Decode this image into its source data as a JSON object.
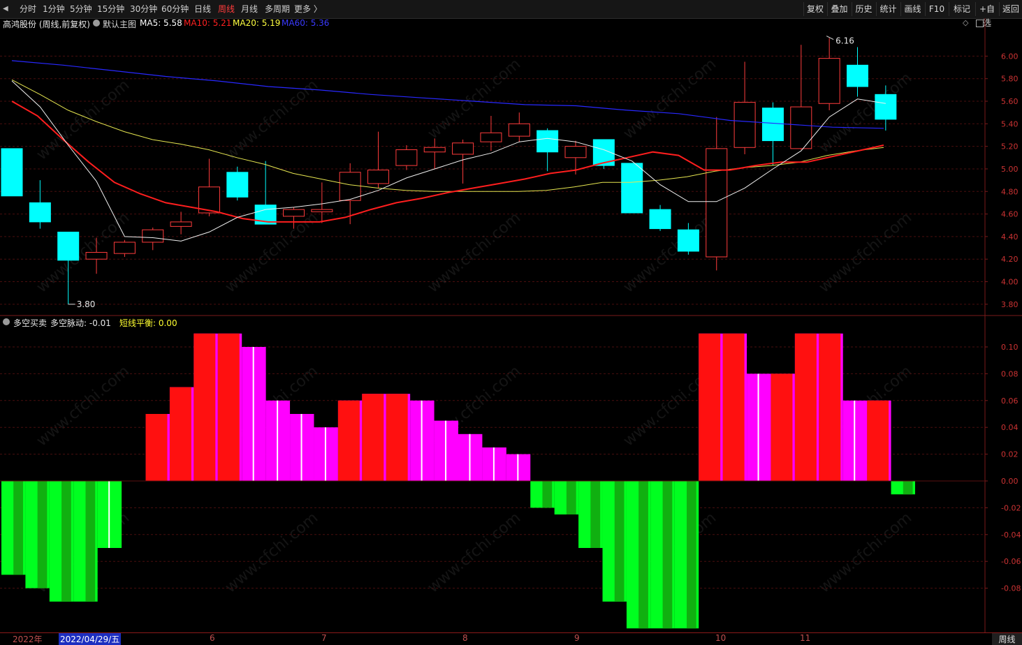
{
  "toolbar": {
    "back_icon": "back-arrow",
    "periods": [
      {
        "label": "分时",
        "active": false
      },
      {
        "label": "1分钟",
        "active": false
      },
      {
        "label": "5分钟",
        "active": false
      },
      {
        "label": "15分钟",
        "active": false
      },
      {
        "label": "30分钟",
        "active": false
      },
      {
        "label": "60分钟",
        "active": false
      },
      {
        "label": "日线",
        "active": false
      },
      {
        "label": "周线",
        "active": true
      },
      {
        "label": "月线",
        "active": false
      },
      {
        "label": "多周期",
        "active": false
      },
      {
        "label": "更多 〉",
        "active": false
      }
    ],
    "right_buttons": [
      "复权",
      "叠加",
      "历史",
      "统计",
      "画线",
      "F10",
      "标记",
      "+自选",
      "返回"
    ]
  },
  "main_chart": {
    "stock_title": "高鸿股份 (周线,前复权)",
    "template_label": "默认主图",
    "ma": [
      {
        "label": "MA5: 5.58",
        "color": "#ffffff"
      },
      {
        "label": "MA10: 5.21",
        "color": "#ff2020"
      },
      {
        "label": "MA20: 5.19",
        "color": "#ffff40"
      },
      {
        "label": "MA60: 5.36",
        "color": "#3a3aff"
      }
    ],
    "price_axis": [
      "6.00",
      "5.80",
      "5.60",
      "5.40",
      "5.20",
      "5.00",
      "4.80",
      "4.60",
      "4.40",
      "4.20",
      "4.00",
      "3.80"
    ],
    "high_label": "6.16",
    "low_label": "3.80",
    "watermark": "www.cfchi.com"
  },
  "sub_chart": {
    "indicator_name": "多空买卖",
    "value1": "多空脉动: -0.01",
    "value2": "短线平衡: 0.00",
    "axis": [
      "0.10",
      "0.08",
      "0.06",
      "0.04",
      "0.02",
      "0.00",
      "-0.02",
      "-0.04",
      "-0.06",
      "-0.08"
    ]
  },
  "footer": {
    "year": "2022年",
    "cursor_date": "2022/04/29/五",
    "months": [
      "6",
      "7",
      "8",
      "9",
      "10",
      "11"
    ],
    "period": "周线"
  },
  "colors": {
    "up": "#ff3c3c",
    "down": "#00ffff",
    "positive_bar": "#ff00ff",
    "negative_bar": "#00ff20",
    "accent": "#ff3c3c"
  },
  "chart_data": [
    {
      "type": "candlestick",
      "title": "高鸿股份 (周线,前复权)",
      "ylim": [
        3.7,
        6.25
      ],
      "candles": [
        {
          "o": 5.18,
          "h": 5.18,
          "l": 4.76,
          "c": 4.76
        },
        {
          "o": 4.7,
          "h": 4.9,
          "l": 4.47,
          "c": 4.53
        },
        {
          "o": 4.44,
          "h": 4.44,
          "l": 3.8,
          "c": 4.19
        },
        {
          "o": 4.2,
          "h": 4.39,
          "l": 4.07,
          "c": 4.26
        },
        {
          "o": 4.25,
          "h": 4.37,
          "l": 4.22,
          "c": 4.35
        },
        {
          "o": 4.35,
          "h": 4.48,
          "l": 4.28,
          "c": 4.46
        },
        {
          "o": 4.49,
          "h": 4.62,
          "l": 4.42,
          "c": 4.53
        },
        {
          "o": 4.61,
          "h": 5.09,
          "l": 4.58,
          "c": 4.84
        },
        {
          "o": 4.97,
          "h": 5.02,
          "l": 4.72,
          "c": 4.75
        },
        {
          "o": 4.68,
          "h": 5.07,
          "l": 4.57,
          "c": 4.51
        },
        {
          "o": 4.58,
          "h": 4.66,
          "l": 4.47,
          "c": 4.64
        },
        {
          "o": 4.62,
          "h": 4.88,
          "l": 4.52,
          "c": 4.64
        },
        {
          "o": 4.72,
          "h": 5.05,
          "l": 4.51,
          "c": 4.97
        },
        {
          "o": 4.87,
          "h": 5.33,
          "l": 4.83,
          "c": 4.99
        },
        {
          "o": 5.03,
          "h": 5.21,
          "l": 4.99,
          "c": 5.17
        },
        {
          "o": 5.15,
          "h": 5.27,
          "l": 5.0,
          "c": 5.19
        },
        {
          "o": 5.13,
          "h": 5.26,
          "l": 4.87,
          "c": 5.23
        },
        {
          "o": 5.24,
          "h": 5.47,
          "l": 5.16,
          "c": 5.32
        },
        {
          "o": 5.29,
          "h": 5.5,
          "l": 5.24,
          "c": 5.4
        },
        {
          "o": 5.34,
          "h": 5.36,
          "l": 4.98,
          "c": 5.15
        },
        {
          "o": 5.1,
          "h": 5.25,
          "l": 4.95,
          "c": 5.2
        },
        {
          "o": 5.26,
          "h": 5.26,
          "l": 5.0,
          "c": 5.03
        },
        {
          "o": 5.05,
          "h": 5.05,
          "l": 4.61,
          "c": 4.61
        },
        {
          "o": 4.64,
          "h": 4.68,
          "l": 4.45,
          "c": 4.47
        },
        {
          "o": 4.46,
          "h": 4.52,
          "l": 4.24,
          "c": 4.27
        },
        {
          "o": 4.22,
          "h": 5.46,
          "l": 4.1,
          "c": 5.18
        },
        {
          "o": 5.19,
          "h": 5.95,
          "l": 5.13,
          "c": 5.59
        },
        {
          "o": 5.54,
          "h": 5.59,
          "l": 5.03,
          "c": 5.25
        },
        {
          "o": 5.18,
          "h": 6.1,
          "l": 5.17,
          "c": 5.55
        },
        {
          "o": 5.58,
          "h": 6.16,
          "l": 5.52,
          "c": 5.98
        },
        {
          "o": 5.92,
          "h": 6.08,
          "l": 5.64,
          "c": 5.73
        },
        {
          "o": 5.66,
          "h": 5.74,
          "l": 5.34,
          "c": 5.44
        }
      ],
      "ma5": [
        null,
        null,
        null,
        null,
        4.4,
        4.39,
        4.36,
        4.44,
        4.57,
        4.64,
        4.66,
        4.69,
        4.73,
        4.81,
        4.92,
        5.0,
        5.08,
        5.14,
        5.24,
        5.27,
        5.24,
        5.17,
        5.07,
        4.86,
        4.71,
        4.71,
        4.83,
        5.0,
        5.16,
        5.46,
        5.62,
        5.58
      ],
      "ma10": [
        5.6,
        5.47,
        5.26,
        5.06,
        4.88,
        4.78,
        4.7,
        4.66,
        4.62,
        4.56,
        4.53,
        4.53,
        4.53,
        4.57,
        4.64,
        4.7,
        4.74,
        4.79,
        4.83,
        4.87,
        4.91,
        4.96,
        4.99,
        5.05,
        5.1,
        5.15,
        5.12,
        4.99,
        4.99,
        5.03,
        5.06,
        5.06,
        5.11,
        5.16,
        5.21
      ],
      "ma20": [
        5.79,
        5.66,
        5.52,
        5.42,
        5.33,
        5.26,
        5.22,
        5.17,
        5.1,
        5.04,
        4.96,
        4.91,
        4.86,
        4.83,
        4.81,
        4.8,
        4.8,
        4.8,
        4.8,
        4.81,
        4.84,
        4.88,
        4.88,
        4.9,
        4.93,
        4.98,
        5.01,
        5.03,
        5.06,
        5.12,
        5.16,
        5.19
      ],
      "ma60": [
        5.96,
        5.92,
        5.87,
        5.82,
        5.78,
        5.73,
        5.7,
        5.66,
        5.63,
        5.6,
        5.57,
        5.56,
        5.52,
        5.49,
        5.43,
        5.4,
        5.37,
        5.36
      ]
    },
    {
      "type": "bar",
      "title": "多空买卖",
      "series": [
        {
          "name": "多空脉动",
          "values": [
            -0.07,
            -0.08,
            -0.09,
            -0.09,
            -0.05,
            0.0,
            0.05,
            0.07,
            0.11,
            0.11,
            0.1,
            0.06,
            0.05,
            0.04,
            0.06,
            0.065,
            0.065,
            0.06,
            0.045,
            0.035,
            0.025,
            0.02,
            -0.02,
            -0.025,
            -0.05,
            -0.09,
            -0.11,
            -0.11,
            -0.11,
            0.11,
            0.11,
            0.08,
            0.08,
            0.11,
            0.11,
            0.06,
            0.06,
            -0.01
          ]
        },
        {
          "name": "短线平衡",
          "values": [
            0.0
          ]
        }
      ],
      "ylim": [
        -0.11,
        0.11
      ]
    }
  ]
}
